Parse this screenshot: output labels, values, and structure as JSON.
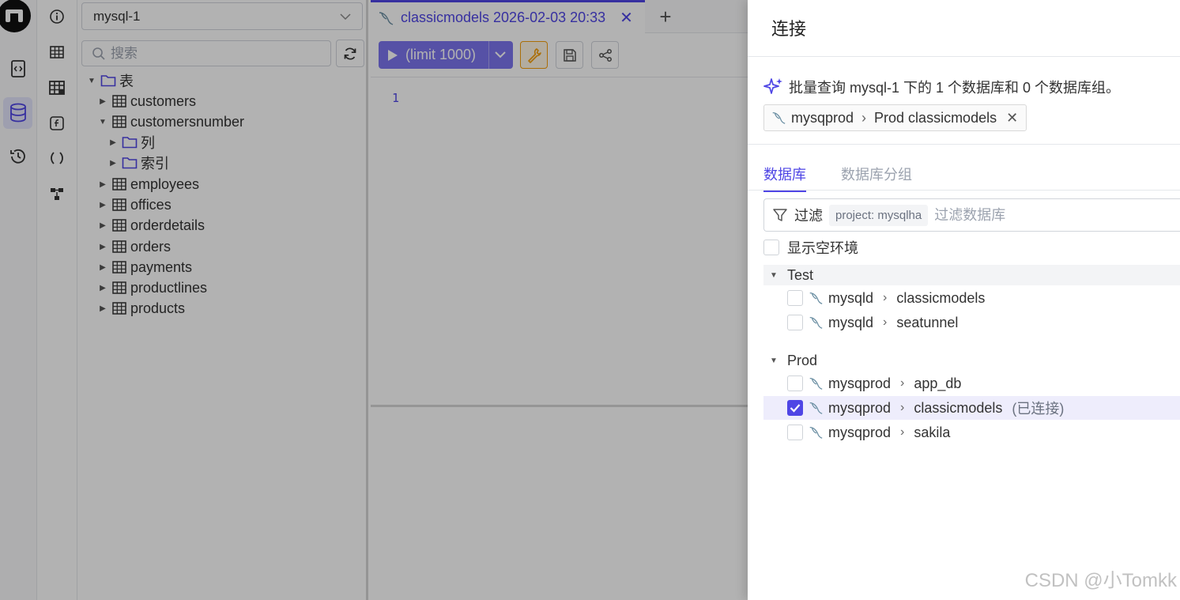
{
  "rail": {
    "icons": [
      "logo",
      "code-file-icon",
      "database-icon",
      "history-icon"
    ]
  },
  "rail2": {
    "icons": [
      "info-icon",
      "table-icon",
      "table-grid-icon",
      "function-icon",
      "parentheses-icon",
      "flow-icon"
    ]
  },
  "schema": {
    "db_selected": "mysql-1",
    "search_placeholder": "搜索",
    "root_label": "表",
    "tables": [
      {
        "label": "customers"
      },
      {
        "label": "customersnumber"
      },
      {
        "label": "employees"
      },
      {
        "label": "offices"
      },
      {
        "label": "orderdetails"
      },
      {
        "label": "orders"
      },
      {
        "label": "payments"
      },
      {
        "label": "productlines"
      },
      {
        "label": "products"
      }
    ],
    "sub_folders": [
      {
        "label": "列"
      },
      {
        "label": "索引"
      }
    ]
  },
  "editor": {
    "tab_title": "classicmodels 2026-02-03 20:33",
    "add_tab": "+",
    "run_label": "(limit 1000)",
    "line_number": "1"
  },
  "drawer": {
    "title": "连接",
    "batch_info": "批量查询 mysql-1 下的 1 个数据库和 0 个数据库组。",
    "chip": {
      "instance": "mysqprod",
      "db": "Prod classicmodels"
    },
    "tabs": [
      "数据库",
      "数据库分组"
    ],
    "filter_label": "过滤",
    "filter_tag": "project: mysqlha",
    "filter_placeholder": "过滤数据库",
    "show_empty_label": "显示空环境",
    "groups": [
      {
        "name": "Test",
        "rows": [
          {
            "instance": "mysqld",
            "database": "classicmodels",
            "tag": "",
            "checked": false
          },
          {
            "instance": "mysqld",
            "database": "seatunnel",
            "tag": "",
            "checked": false
          }
        ]
      },
      {
        "name": "Prod",
        "rows": [
          {
            "instance": "mysqprod",
            "database": "app_db",
            "tag": "",
            "checked": false
          },
          {
            "instance": "mysqprod",
            "database": "classicmodels",
            "tag": "(已连接)",
            "checked": true
          },
          {
            "instance": "mysqprod",
            "database": "sakila",
            "tag": "",
            "checked": false
          }
        ]
      }
    ]
  },
  "watermark": "CSDN @小Tomkk",
  "colors": {
    "accent": "#4f46e5",
    "run_button": "#7c75ee",
    "wrench_border": "#f59e0b"
  }
}
